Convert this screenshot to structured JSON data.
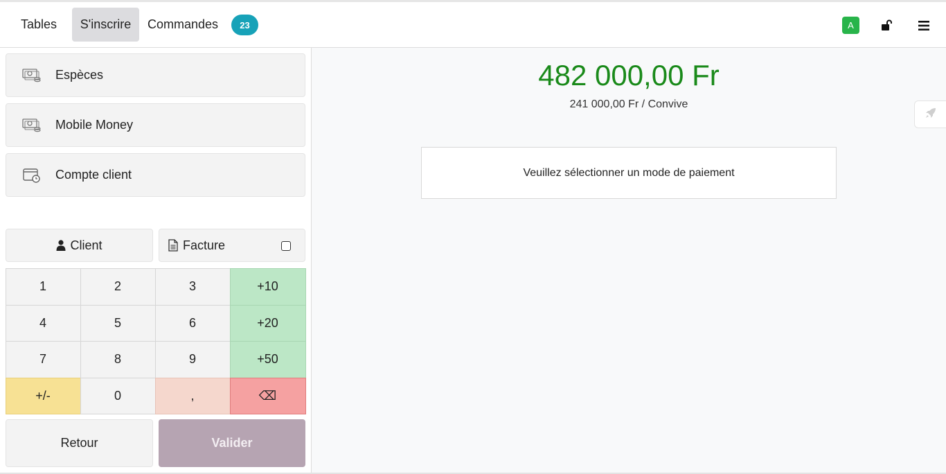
{
  "nav": {
    "tabs": [
      {
        "label": "Tables"
      },
      {
        "label": "S'inscrire",
        "active": true
      },
      {
        "label": "Commandes"
      }
    ],
    "orders_count": "23",
    "user_initial": "A",
    "icons": {
      "lock": "unlock-icon",
      "menu": "hamburger-menu-icon"
    }
  },
  "payment_methods": [
    {
      "label": "Espèces",
      "icon": "cash-icon"
    },
    {
      "label": "Mobile Money",
      "icon": "cash-icon"
    },
    {
      "label": "Compte client",
      "icon": "wallet-clock-icon"
    }
  ],
  "client_button": {
    "label": "Client",
    "icon": "user-icon"
  },
  "invoice_button": {
    "label": "Facture",
    "icon": "document-icon",
    "checked": false
  },
  "numpad": {
    "keys": [
      "1",
      "2",
      "3",
      "+10",
      "4",
      "5",
      "6",
      "+20",
      "7",
      "8",
      "9",
      "+50",
      "+/-",
      "0",
      ",",
      "⌫"
    ]
  },
  "actions": {
    "back": "Retour",
    "validate": "Valider"
  },
  "summary": {
    "total": "482 000,00 Fr",
    "per_guest": "241 000,00 Fr / Convive",
    "notice": "Veuillez sélectionner un mode de paiement"
  },
  "colors": {
    "total": "#1a8a1a",
    "badge": "#17a2b8",
    "user_badge": "#28b44a",
    "quick_add": "#bce7c6",
    "sign": "#f7e194",
    "comma": "#f5d7cd",
    "backspace": "#f5a1a1",
    "validate": "#b6a4b2"
  }
}
